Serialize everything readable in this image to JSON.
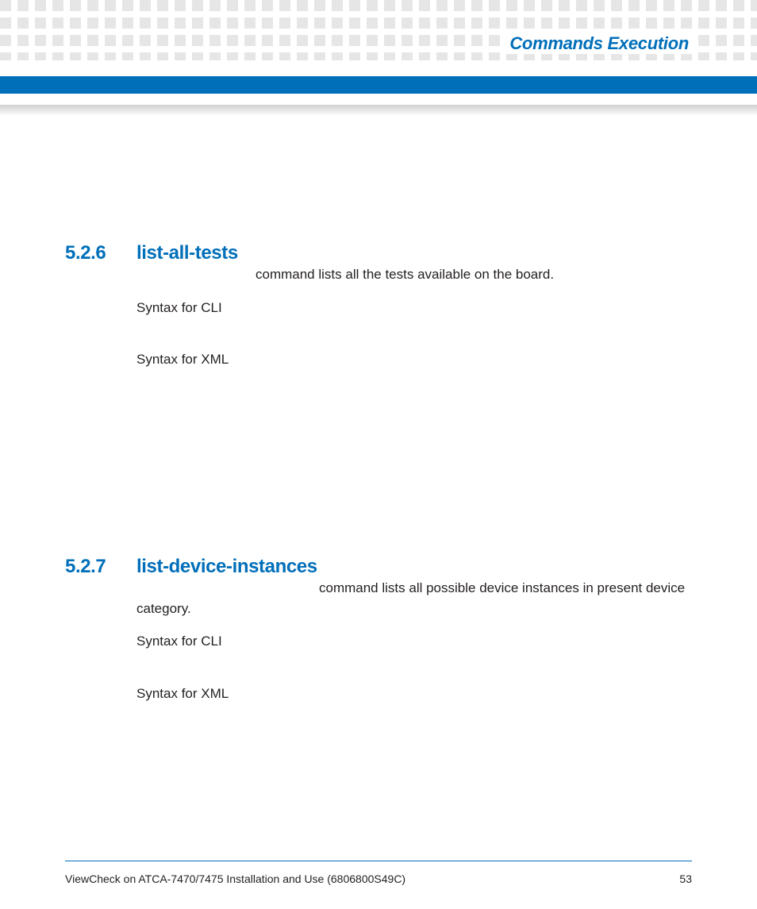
{
  "header": {
    "title": "Commands Execution"
  },
  "sections": [
    {
      "number": "5.2.6",
      "title": "list-all-tests",
      "description": " command lists all the tests available on the board.",
      "syntax_cli_label": "Syntax for CLI",
      "syntax_xml_label": "Syntax for XML"
    },
    {
      "number": "5.2.7",
      "title": "list-device-instances",
      "description": " command lists all possible device instances in present device category.",
      "syntax_cli_label": "Syntax for CLI",
      "syntax_xml_label": "Syntax for XML"
    }
  ],
  "footer": {
    "doc_title": "ViewCheck on ATCA-7470/7475 Installation and Use (6806800S49C)",
    "page_number": "53"
  }
}
